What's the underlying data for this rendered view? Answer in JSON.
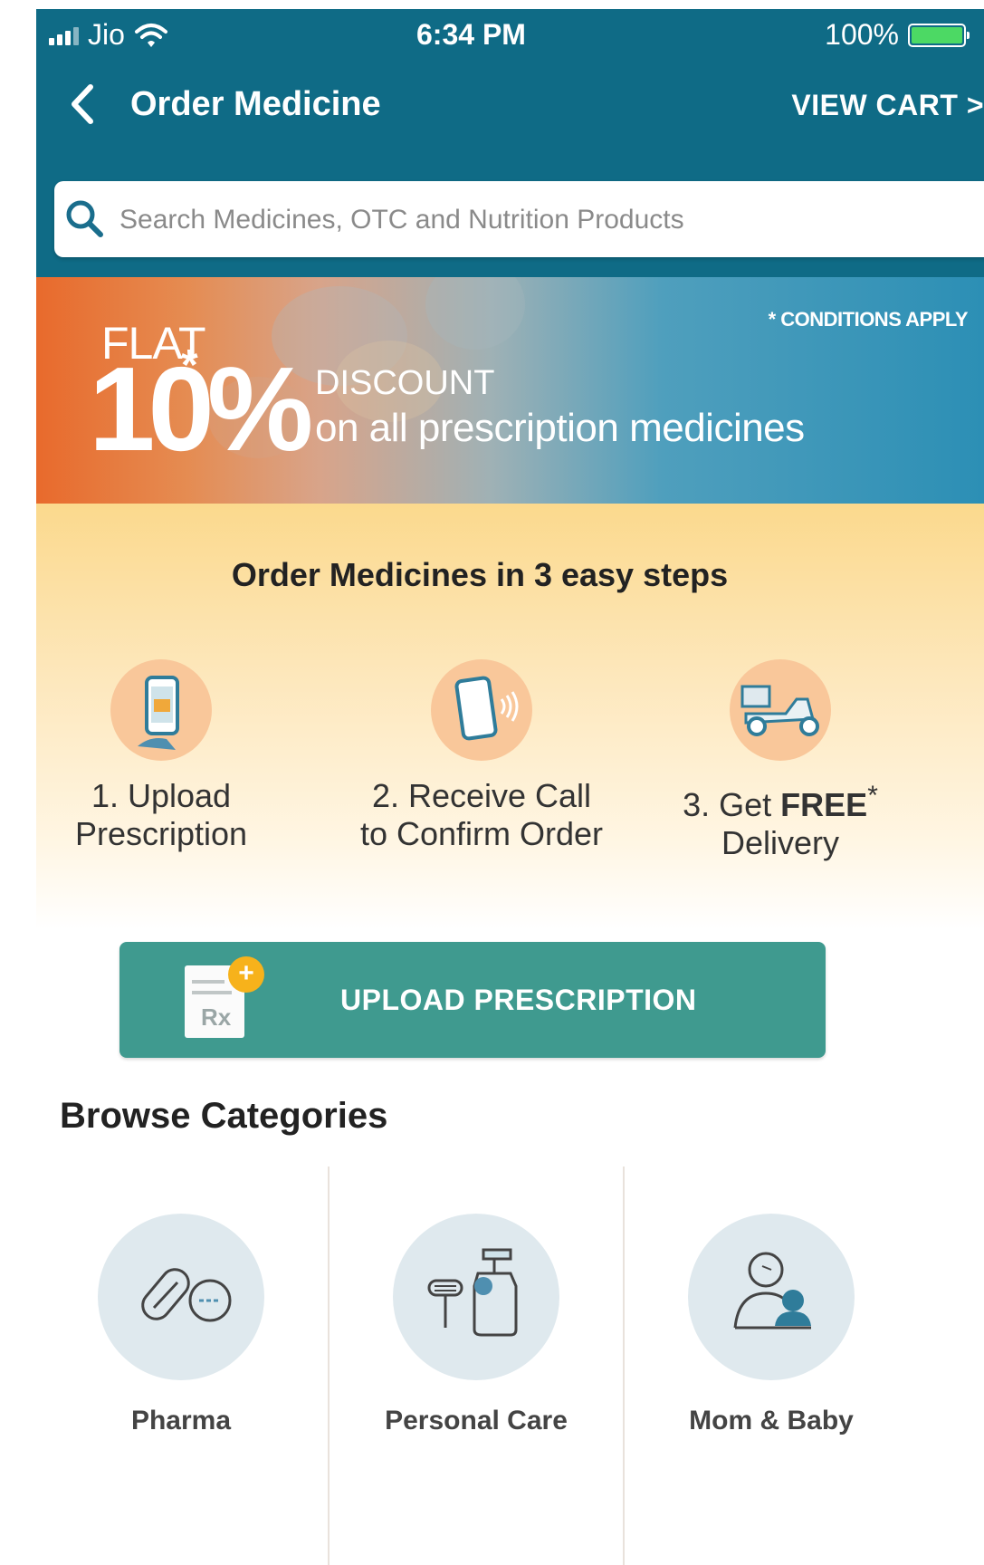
{
  "status_bar": {
    "carrier": "Jio",
    "time": "6:34 PM",
    "battery": "100%"
  },
  "header": {
    "title": "Order Medicine",
    "view_cart": "VIEW CART >"
  },
  "search": {
    "placeholder": "Search Medicines, OTC and Nutrition Products"
  },
  "banner": {
    "flat": "FLAT",
    "percent": "10%",
    "asterisk": "*",
    "discount": "DISCOUNT",
    "subtitle": "on all prescription medicines",
    "conditions": "* CONDITIONS APPLY"
  },
  "steps": {
    "title": "Order Medicines in 3 easy steps",
    "items": [
      {
        "line1": "1. Upload",
        "line2": "Prescription",
        "icon": "phone-upload-icon"
      },
      {
        "line1": "2. Receive Call",
        "line2": "to Confirm Order",
        "icon": "phone-ringing-icon"
      },
      {
        "line1_prefix": "3. Get ",
        "line1_bold": "FREE",
        "line1_sup": "*",
        "line2": "Delivery",
        "icon": "delivery-scooter-icon"
      }
    ]
  },
  "upload": {
    "label": "UPLOAD PRESCRIPTION",
    "doc_text": "Rx",
    "plus": "+"
  },
  "categories": {
    "title": "Browse Categories",
    "items": [
      {
        "label": "Pharma",
        "icon": "pills-icon"
      },
      {
        "label": "Personal Care",
        "icon": "personal-care-icon"
      },
      {
        "label": "Mom & Baby",
        "icon": "mom-baby-icon"
      }
    ]
  },
  "colors": {
    "header": "#0f6b86",
    "upload_button": "#3f9a8f",
    "step_circle": "#f9c79a",
    "category_circle": "#dfe9ee",
    "accent_plus": "#f7b21b"
  }
}
